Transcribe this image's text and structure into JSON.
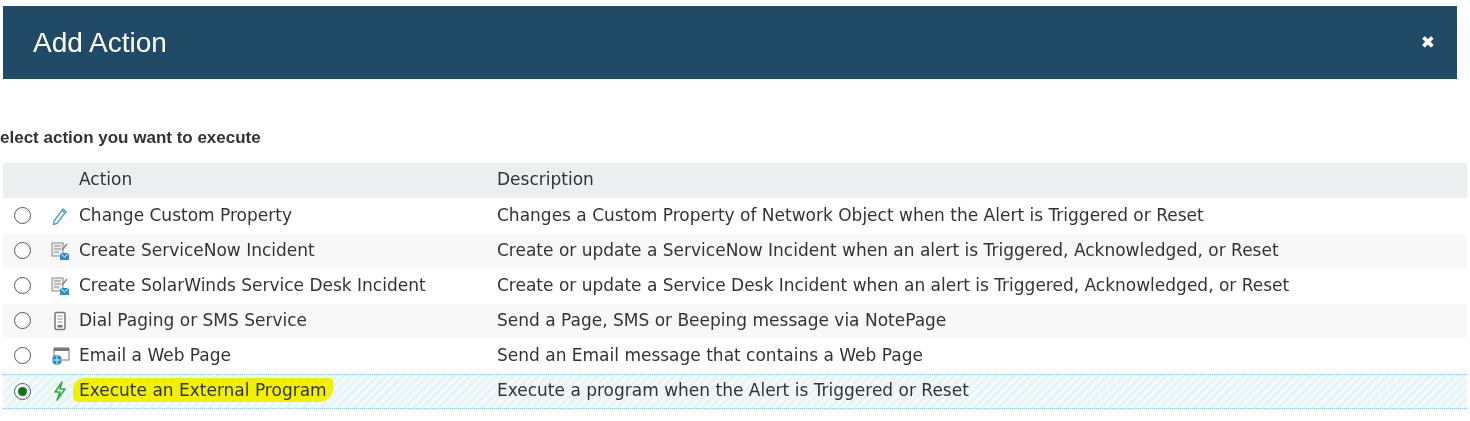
{
  "dialog": {
    "title": "Add Action",
    "close": "✖"
  },
  "prompt": "elect action you want to execute",
  "table": {
    "columns": [
      "Action",
      "Description"
    ],
    "rows": [
      {
        "kind": "pencil",
        "action": "Change Custom Property",
        "description": "Changes a Custom Property of Network Object when the Alert is Triggered or Reset",
        "selected": false
      },
      {
        "kind": "ticket",
        "action": "Create ServiceNow Incident",
        "description": "Create or update a ServiceNow Incident when an alert is Triggered, Acknowledged, or Reset",
        "selected": false
      },
      {
        "kind": "ticket",
        "action": "Create SolarWinds Service Desk Incident",
        "description": "Create or update a Service Desk Incident when an alert is Triggered, Acknowledged, or Reset",
        "selected": false
      },
      {
        "kind": "pager",
        "action": "Dial Paging or SMS Service",
        "description": "Send a Page, SMS or Beeping message via NotePage",
        "selected": false
      },
      {
        "kind": "webpage",
        "action": "Email a Web Page",
        "description": "Send an Email message that contains a Web Page",
        "selected": false
      },
      {
        "kind": "bolt",
        "action": "Execute an External Program",
        "description": "Execute a program when the Alert is Triggered or Reset",
        "selected": true
      }
    ]
  }
}
